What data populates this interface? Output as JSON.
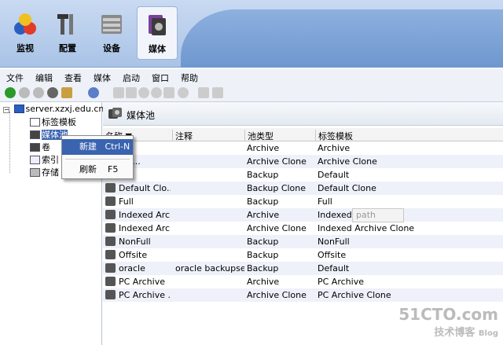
{
  "top_tabs": [
    "监视",
    "配置",
    "设备",
    "媒体"
  ],
  "menus": [
    "文件",
    "编辑",
    "查看",
    "媒体",
    "启动",
    "窗口",
    "帮助"
  ],
  "tree": {
    "server": "server.xzxj.edu.cn",
    "items": [
      "标签模板",
      "媒体池",
      "卷",
      "索引",
      "存储"
    ]
  },
  "panel_title": "媒体池",
  "columns": [
    "名称",
    "注释",
    "池类型",
    "标签模板"
  ],
  "rows": [
    {
      "name": "",
      "comment": "",
      "type": "Archive",
      "template": "Archive"
    },
    {
      "name": "Clo...",
      "comment": "",
      "type": "Archive Clone",
      "template": "Archive Clone"
    },
    {
      "name": "",
      "comment": "",
      "type": "Backup",
      "template": "Default"
    },
    {
      "name": "Default Clo...",
      "comment": "",
      "type": "Backup Clone",
      "template": "Default Clone"
    },
    {
      "name": "Full",
      "comment": "",
      "type": "Backup",
      "template": "Full"
    },
    {
      "name": "Indexed Arc...",
      "comment": "",
      "type": "Archive",
      "template": "Indexed Archive"
    },
    {
      "name": "Indexed Arc...",
      "comment": "",
      "type": "Archive Clone",
      "template": "Indexed Archive Clone"
    },
    {
      "name": "NonFull",
      "comment": "",
      "type": "Backup",
      "template": "NonFull"
    },
    {
      "name": "Offsite",
      "comment": "",
      "type": "Backup",
      "template": "Offsite"
    },
    {
      "name": "oracle",
      "comment": "oracle backupset",
      "type": "Backup",
      "template": "Default"
    },
    {
      "name": "PC Archive",
      "comment": "",
      "type": "Archive",
      "template": "PC Archive"
    },
    {
      "name": "PC Archive ...",
      "comment": "",
      "type": "Archive Clone",
      "template": "PC Archive Clone"
    }
  ],
  "context_menu": {
    "new_label": "新建",
    "new_shortcut": "Ctrl-N",
    "refresh_label": "刷新",
    "refresh_shortcut": "F5"
  },
  "tooltip": "path",
  "watermark": {
    "line1": "51CTO.com",
    "line2": "技术博客",
    "line3": "Blog"
  },
  "colors": {
    "selection": "#3a64b0",
    "topbar": "#a9c3e6"
  }
}
